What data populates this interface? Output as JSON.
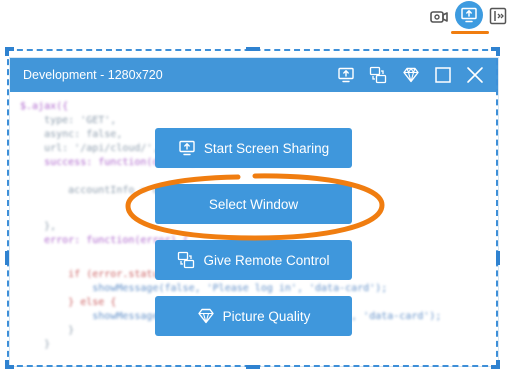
{
  "toolbar": {
    "icons": [
      "camera-icon",
      "screen-share-icon",
      "sidebar-toggle-icon"
    ],
    "accent_color": "#3d9be0",
    "highlight_color": "#f07d10"
  },
  "window": {
    "title": "Development - 1280x720",
    "titlebar_color": "#4296d9",
    "titlebar_icons": [
      "screen-share-icon",
      "remote-control-icon",
      "diamond-icon",
      "maximize-icon",
      "close-icon"
    ]
  },
  "code": {
    "lines": [
      "$.ajax({",
      "    type: 'GET',",
      "    async: false,",
      "    url: '/api/cloud/',",
      "    success: function(data) {",
      "",
      "        accountInfo = data;",
      "",
      "    },",
      "    error: function(error) {",
      "",
      "        if (error.status == 401) {",
      "            showMessage(false, 'Please log in', 'data-card');",
      "        } else {",
      "            showMessage(false, buildErrorMessage(error), 'data-card');",
      "        }",
      "    }"
    ]
  },
  "actions": {
    "start_sharing": "Start Screen Sharing",
    "select_window": "Select Window",
    "remote_control": "Give Remote Control",
    "picture_quality": "Picture Quality"
  }
}
